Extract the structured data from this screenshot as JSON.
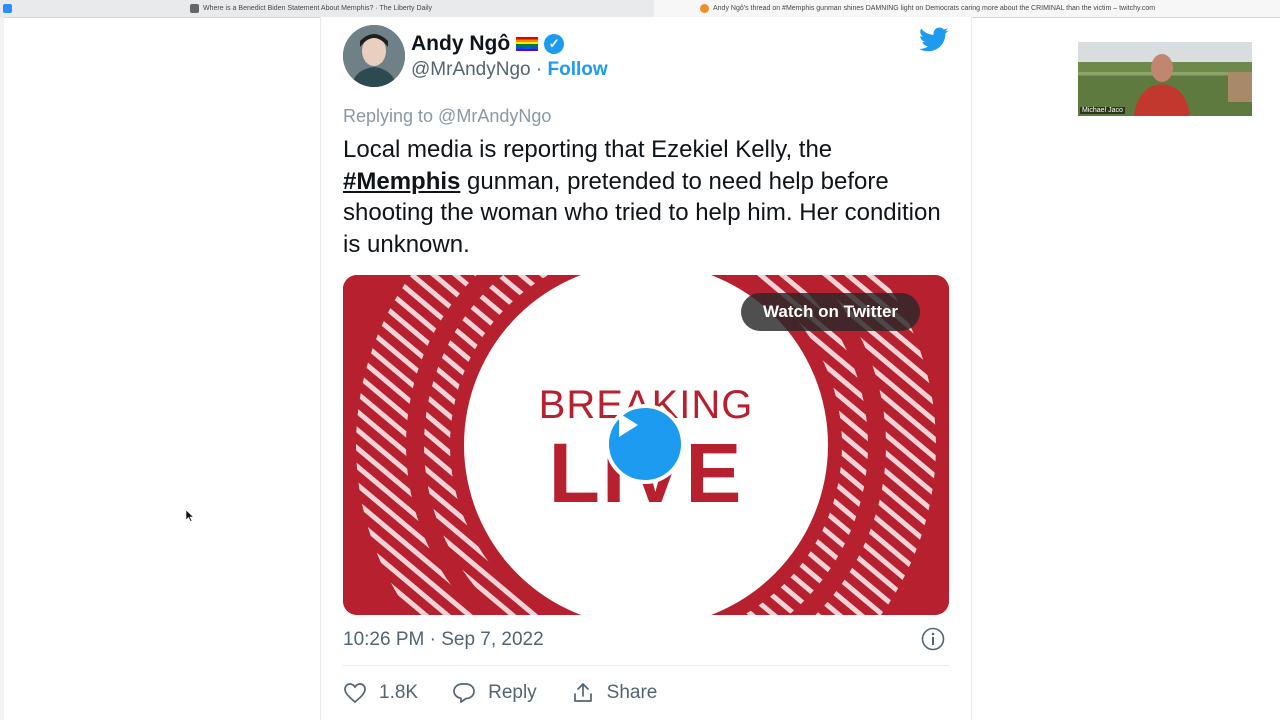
{
  "browser": {
    "tabs": [
      {
        "title": "Where is a Benedict Biden Statement About Memphis? · The Liberty Daily",
        "active": false
      },
      {
        "title": "Andy Ngô's thread on #Memphis gunman shines DAMNING light on Democrats caring more about the CRIMINAL than the victim – twitchy.com",
        "active": true
      }
    ]
  },
  "tweet": {
    "author_name": "Andy Ngô",
    "handle": "@MrAndyNgo",
    "separator": "·",
    "follow_label": "Follow",
    "replying_to": "Replying to @MrAndyNgo",
    "text_part1": "Local media is reporting that Ezekiel Kelly, the",
    "hashtag": "#Memphis",
    "text_part2": " gunman, pretended to need help before shooting the woman who tried to help him. Her condition is unknown.",
    "media": {
      "watch_label": "Watch on Twitter",
      "breaking_text": "BREAKING",
      "live_text": "LIVE"
    },
    "timestamp": "10:26 PM · Sep 7, 2022",
    "likes": "1.8K",
    "reply_label": "Reply",
    "share_label": "Share"
  },
  "webcam": {
    "name_label": "Michael Jaco"
  },
  "colors": {
    "twitter_blue": "#1d9bf0",
    "breaking_red": "#b7202e",
    "text_gray": "#536471"
  }
}
